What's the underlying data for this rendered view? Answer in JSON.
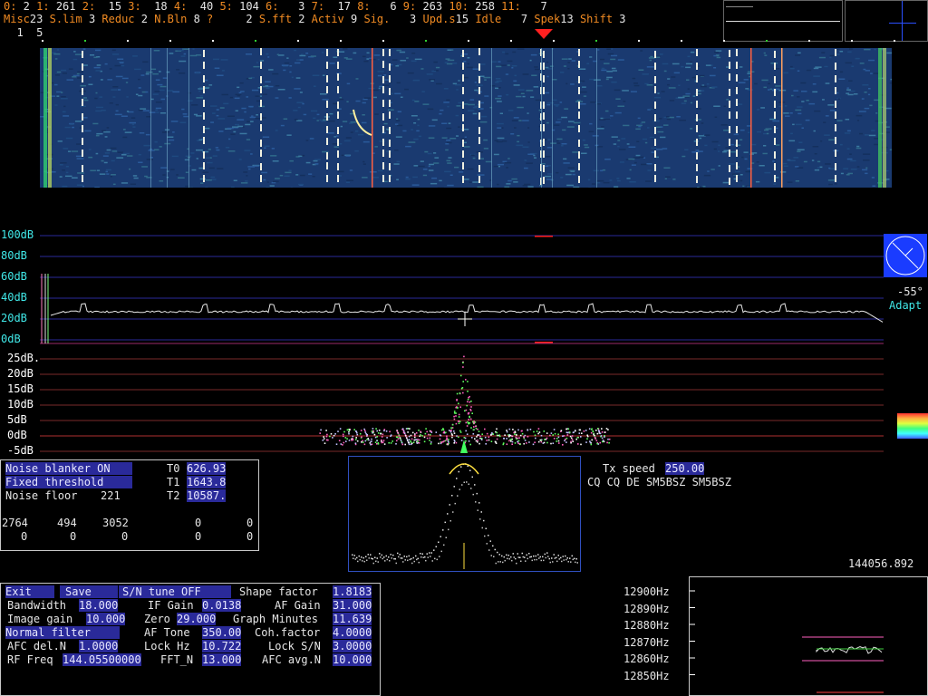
{
  "header": {
    "row1": [
      {
        "k": "0:",
        "v": " 2"
      },
      {
        "k": "1:",
        "v": " 261"
      },
      {
        "k": "2:",
        "v": "  15"
      },
      {
        "k": "3:",
        "v": "  18"
      },
      {
        "k": "4:",
        "v": "  40"
      },
      {
        "k": "5:",
        "v": " 104"
      },
      {
        "k": "6:",
        "v": "   3"
      },
      {
        "k": "7:",
        "v": "  17"
      },
      {
        "k": "8:",
        "v": "   6"
      },
      {
        "k": "9:",
        "v": " 263"
      },
      {
        "k": "10:",
        "v": " 258"
      },
      {
        "k": "11:",
        "v": "   7"
      }
    ],
    "row2": [
      {
        "k": "Misc",
        "v": "23"
      },
      {
        "k": "S.lim",
        "v": " 3"
      },
      {
        "k": "Reduc",
        "v": " 2"
      },
      {
        "k": "N.Bln",
        "v": " 8"
      },
      {
        "k": "?",
        "v": "     2"
      },
      {
        "k": "S.fft",
        "v": " 2"
      },
      {
        "k": "Activ",
        "v": " 9"
      },
      {
        "k": "Sig.",
        "v": "   3"
      },
      {
        "k": "Upd.s",
        "v": "15"
      },
      {
        "k": "Idle",
        "v": "   7"
      },
      {
        "k": "Spek",
        "v": "13"
      },
      {
        "k": "Shift",
        "v": " 3"
      }
    ],
    "row3": "  1  5"
  },
  "spectrum_db_labels": [
    "100dB",
    "80dB",
    "60dB",
    "40dB",
    "20dB",
    "0dB"
  ],
  "baseband_db_labels": [
    "25dB.",
    "20dB",
    "15dB",
    "10dB",
    "5dB",
    "0dB",
    "-5dB"
  ],
  "angle": {
    "value": "-55°",
    "mode": "Adapt"
  },
  "noise_panel": {
    "blanker": "Noise blanker ON",
    "threshold": "Fixed threshold",
    "floor_label": "Noise floor",
    "floor_value": "221",
    "t0_label": "T0",
    "t0": "626.93",
    "t1_label": "T1",
    "t1": "1643.8",
    "t2_label": "T2",
    "t2": "10587.",
    "row_a": [
      "2764",
      "494",
      "3052",
      "0",
      "0"
    ],
    "row_b": [
      "0",
      "0",
      "0",
      "0",
      "0"
    ]
  },
  "tx": {
    "speed_label": "Tx speed",
    "speed": "250.00",
    "message": "CQ CQ DE SM5BSZ SM5BSZ"
  },
  "frequency_readout": "144056.892",
  "params": {
    "exit": "Exit",
    "save": "Save",
    "sn_tune": "S/N tune OFF",
    "shape_label": "Shape factor",
    "shape": "1.8183",
    "bw_label": "Bandwidth",
    "bw": "18.000",
    "ifgain_label": "IF Gain",
    "ifgain": "0.0138",
    "afgain_label": "AF Gain",
    "afgain": "31.000",
    "imgain_label": "Image gain",
    "imgain": "10.000",
    "zero_label": "Zero",
    "zero": "29.000",
    "graph_label": "Graph Minutes",
    "graph": "11.639",
    "filter": "Normal filter",
    "aftone_label": "AF Tone",
    "aftone": "350.00",
    "coh_label": "Coh.factor",
    "coh": "4.0000",
    "afcdel_label": "AFC del.N",
    "afcdel": "1.0000",
    "lockhz_label": "Lock Hz",
    "lockhz": "10.722",
    "locksn_label": "Lock S/N",
    "locksn": "3.0000",
    "rf_label": "RF Freq",
    "rf": "144.05500000",
    "fftn_label": "FFT_N",
    "fftn": "13.000",
    "afcavg_label": "AFC avg.N",
    "afcavg": "10.000"
  },
  "afc_hz_labels": [
    "12900Hz",
    "12890Hz",
    "12880Hz",
    "12870Hz",
    "12860Hz",
    "12850Hz"
  ],
  "colors": {
    "accent": "#2a2a9a",
    "header_key": "#f08a22",
    "db_label": "#40e8e8",
    "marker": "#ff2020"
  }
}
